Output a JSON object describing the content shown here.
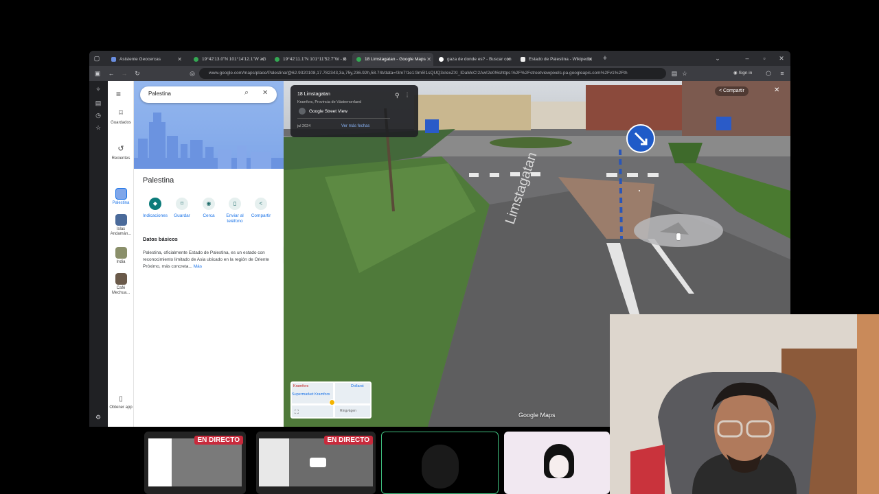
{
  "browser": {
    "tabs": [
      {
        "label": "Asistente Geocercas",
        "active": false
      },
      {
        "label": "19°42'13.0\"N 101°14'12.1\"W - G",
        "active": false
      },
      {
        "label": "19°42'11.1\"N 101°11'52.7\"W - G",
        "active": false
      },
      {
        "label": "18 Limstagatan - Google Maps",
        "active": true
      },
      {
        "label": "gaza de donde es? - Buscar con",
        "active": false
      },
      {
        "label": "Estado de Palestina - Wikipedia",
        "active": false
      }
    ],
    "new_tab": "+",
    "url": "www.google.com/maps/place/Palestina/@62.9320108,17.782343,3a,75y,236.92h,58.74t/data=!3m7!1e1!3m5!1sQUQ3cIexZXl_IDaMcC!2Aw!2e0!6shttps:%2F%2Fstreetviewpixels-pa.googleapis.com%2Fv1%2Fth",
    "signin": "Sign in"
  },
  "maps_rail": {
    "menu_icon": "menu-icon",
    "items": [
      {
        "label": "Guardados",
        "icon": "bookmark-icon"
      },
      {
        "label": "Recientes",
        "icon": "history-icon"
      },
      {
        "label": "Palestina",
        "thumb_color": "#7fa6e9"
      },
      {
        "label": "Islas Andamán...",
        "thumb_color": "#4a6a9a"
      },
      {
        "label": "India",
        "thumb_color": "#8a8f6a"
      },
      {
        "label": "Café Mechua...",
        "thumb_color": "#6a5a4a"
      }
    ],
    "get_app": "Obtener app"
  },
  "panel": {
    "search_value": "Palestina",
    "place_title": "Palestina",
    "actions": [
      {
        "label": "Indicaciones",
        "icon": "directions-icon"
      },
      {
        "label": "Guardar",
        "icon": "bookmark-icon"
      },
      {
        "label": "Cerca",
        "icon": "nearby-icon"
      },
      {
        "label": "Enviar al teléfono",
        "icon": "phone-icon"
      },
      {
        "label": "Compartir",
        "icon": "share-icon"
      }
    ],
    "basics_heading": "Datos básicos",
    "basics_text": "Palestina, oficialmente Estado de Palestina, es un estado con reconocimiento limitado de Asia ubicado en la región de Oriente Próximo, más concreta...",
    "more_link": "Más"
  },
  "street": {
    "address": "18 Limstagatan",
    "region": "Kramfors, Provincia de Västernorrland",
    "source": "Google Street View",
    "date": "jul 2024",
    "more_dates": "Ver más fechas",
    "share": "Compartir",
    "street_sign": "Limstagatan",
    "watermark": "Google Maps",
    "minimap_place": "Supermarket Kramfors",
    "minimap_town": "Kramfors",
    "minimap_shop": "Dollarst",
    "minimap_road": "Ringvägen"
  },
  "streams": [
    {
      "live": "EN DIRECTO"
    },
    {
      "live": "EN DIRECTO"
    },
    {
      "live": ""
    },
    {
      "live": ""
    }
  ]
}
